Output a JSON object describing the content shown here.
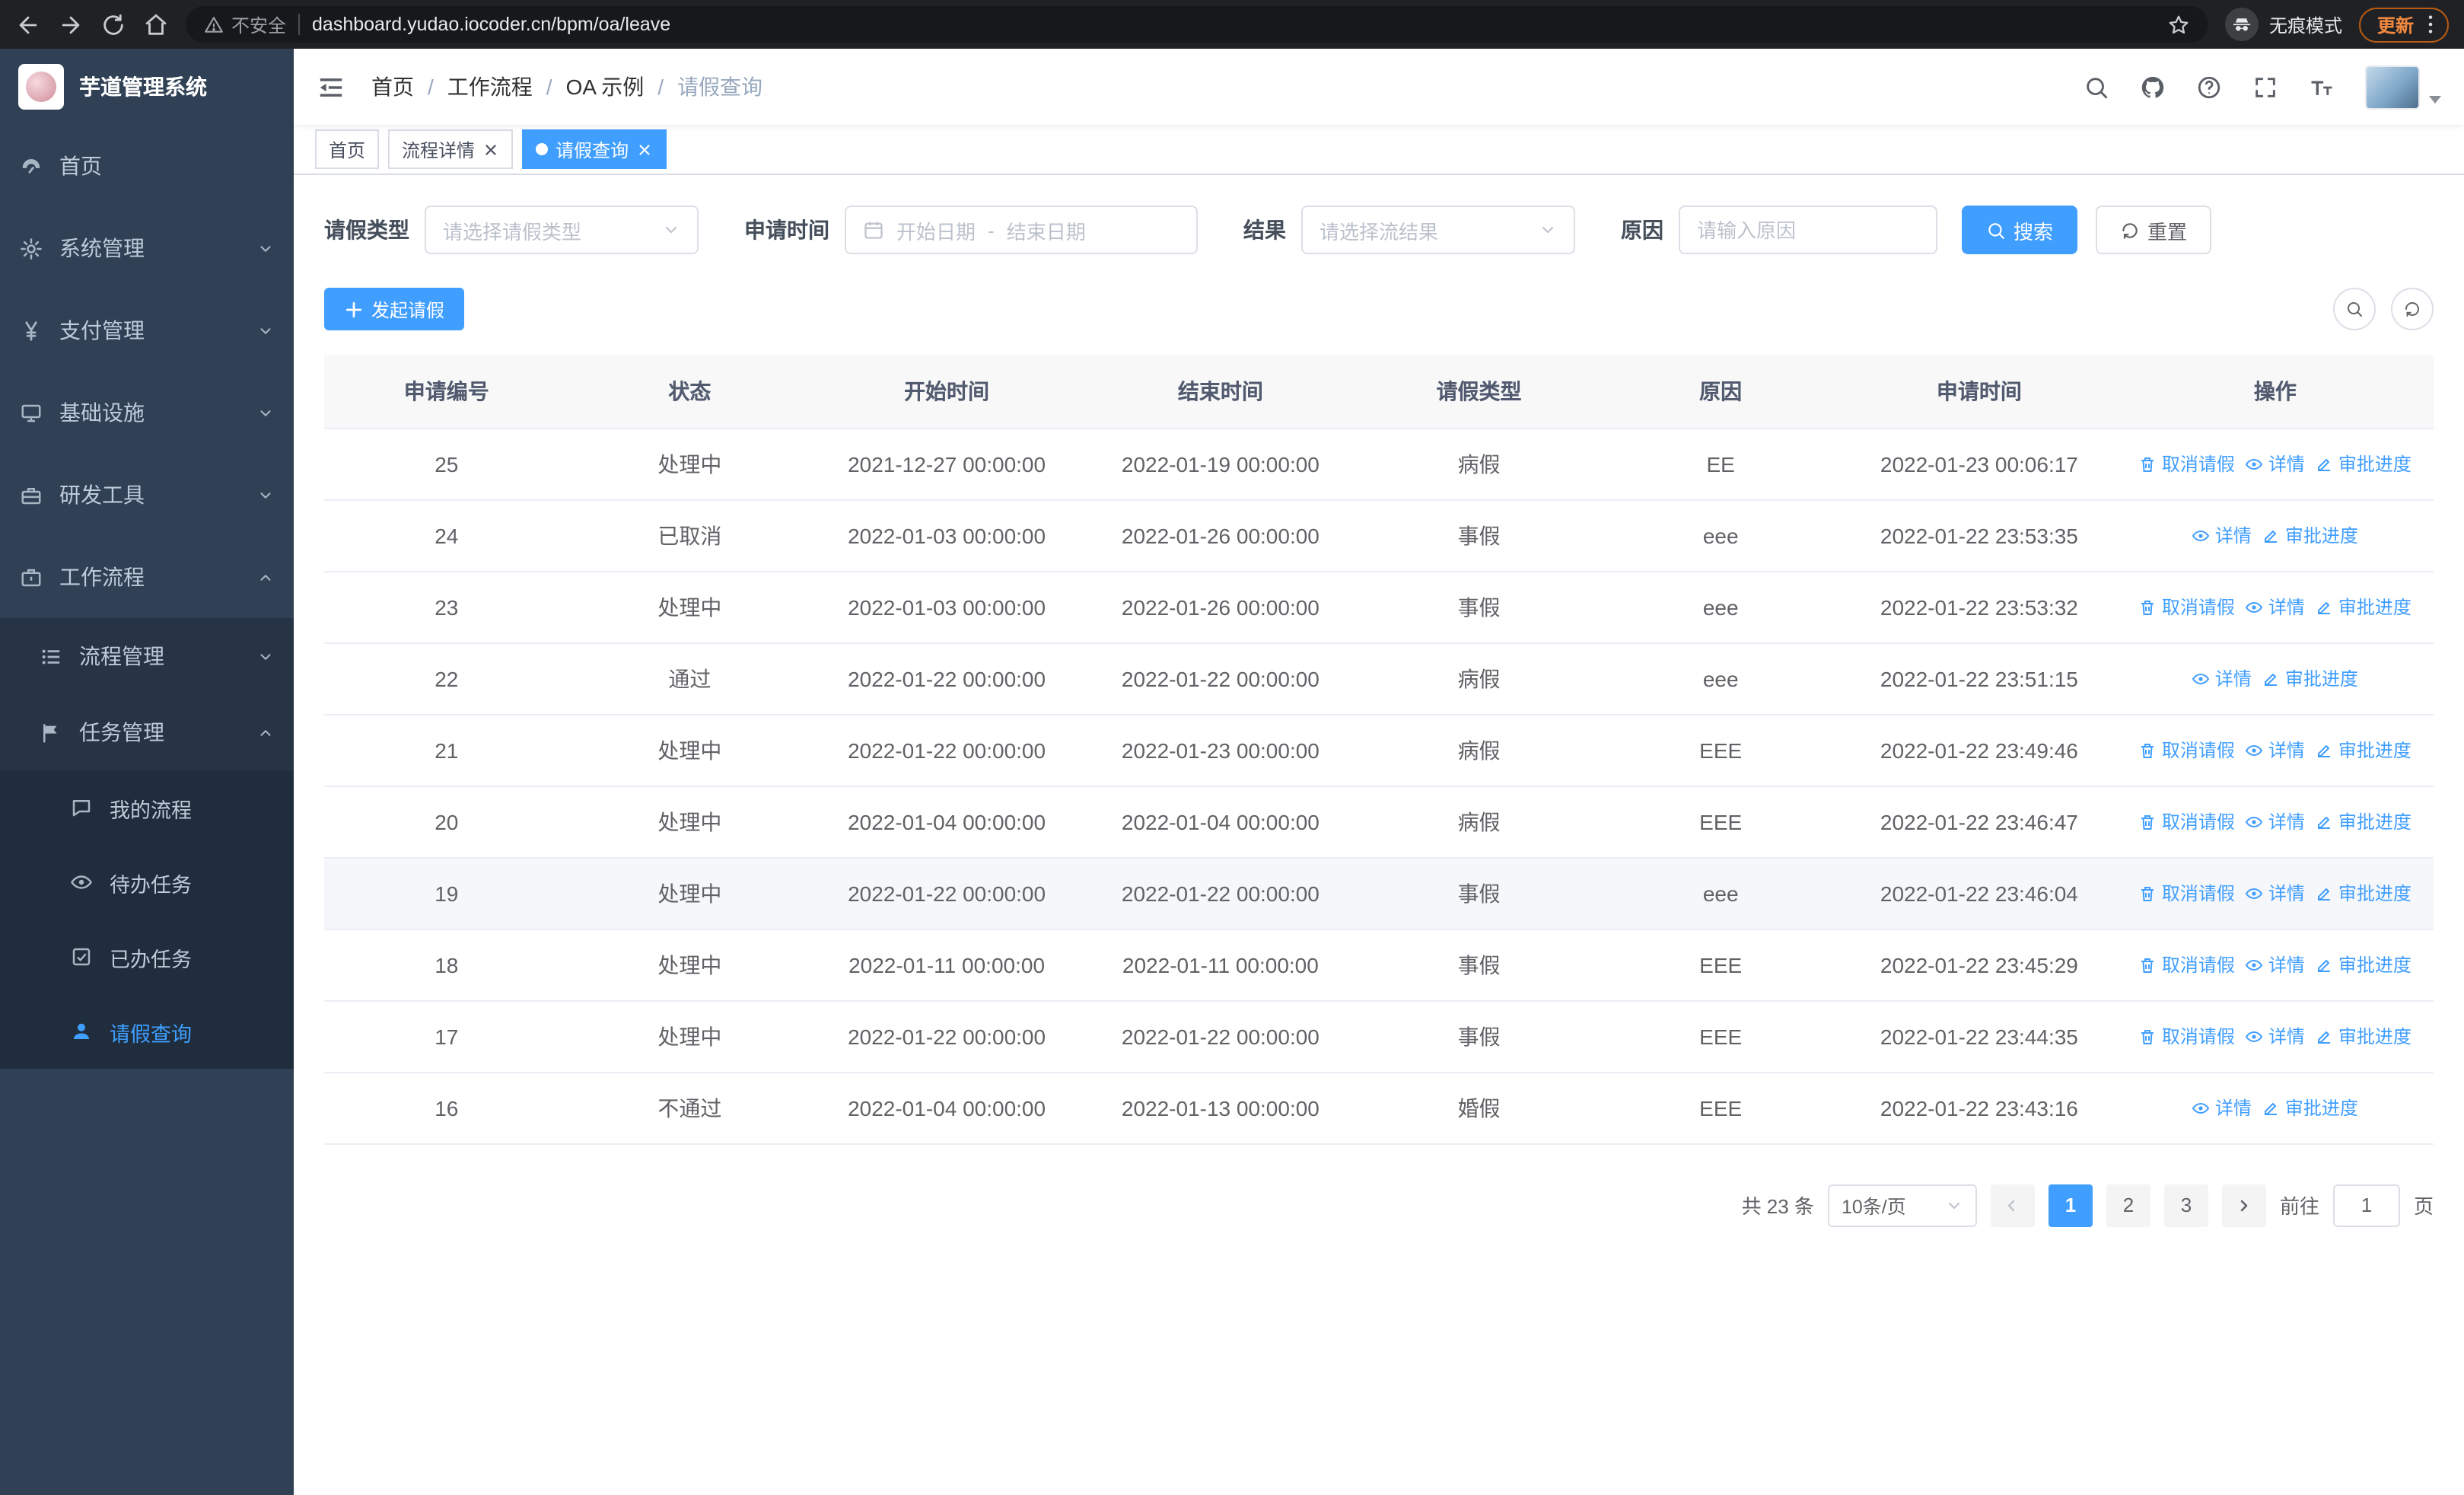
{
  "colors": {
    "accent": "#409eff",
    "sidebar_bg": "#304156",
    "sidebar_sub_bg": "#263445",
    "sidebar_deep_bg": "#1f2d3d",
    "chrome_bg": "#202124",
    "update_orange": "#f0883e",
    "table_header_bg": "#f8f8f9"
  },
  "browser": {
    "security_label": "不安全",
    "url": "dashboard.yudao.iocoder.cn/bpm/oa/leave",
    "incognito_label": "无痕模式",
    "update_label": "更新",
    "icons": [
      "arrow-left-icon",
      "arrow-right-icon",
      "reload-icon",
      "home-icon",
      "warning-icon",
      "star-icon",
      "incognito-icon",
      "dots-vertical-icon"
    ]
  },
  "sidebar": {
    "logo_title": "芋道管理系统",
    "items": [
      {
        "label": "首页",
        "icon": "dashboard-icon",
        "level": 1
      },
      {
        "label": "系统管理",
        "icon": "gear-icon",
        "level": 1,
        "chevron": "down"
      },
      {
        "label": "支付管理",
        "icon": "yen-icon",
        "level": 1,
        "chevron": "down"
      },
      {
        "label": "基础设施",
        "icon": "monitor-icon",
        "level": 1,
        "chevron": "down"
      },
      {
        "label": "研发工具",
        "icon": "toolbox-icon",
        "level": 1,
        "chevron": "down"
      },
      {
        "label": "工作流程",
        "icon": "briefcase-icon",
        "level": 1,
        "chevron": "up"
      },
      {
        "label": "流程管理",
        "icon": "list-icon",
        "level": 2,
        "chevron": "down"
      },
      {
        "label": "任务管理",
        "icon": "flag-icon",
        "level": 2,
        "chevron": "up"
      },
      {
        "label": "我的流程",
        "icon": "chat-icon",
        "level": 3
      },
      {
        "label": "待办任务",
        "icon": "eye-icon",
        "level": 3
      },
      {
        "label": "已办任务",
        "icon": "done-icon",
        "level": 3
      },
      {
        "label": "请假查询",
        "icon": "user-icon",
        "level": 3,
        "active": true
      }
    ]
  },
  "breadcrumb": {
    "separator": "/",
    "items": [
      "首页",
      "工作流程",
      "OA 示例",
      "请假查询"
    ]
  },
  "header_icons": [
    "search-icon",
    "github-icon",
    "help-icon",
    "fullscreen-icon",
    "fontsize-icon"
  ],
  "tabs": [
    {
      "label": "首页",
      "closable": false,
      "active": false
    },
    {
      "label": "流程详情",
      "closable": true,
      "active": false
    },
    {
      "label": "请假查询",
      "closable": true,
      "active": true
    }
  ],
  "filters": {
    "leave_type_label": "请假类型",
    "leave_type_placeholder": "请选择请假类型",
    "apply_time_label": "申请时间",
    "start_date_placeholder": "开始日期",
    "range_separator": "-",
    "end_date_placeholder": "结束日期",
    "result_label": "结果",
    "result_placeholder": "请选择流结果",
    "reason_label": "原因",
    "reason_placeholder": "请输入原因",
    "search_label": "搜索",
    "reset_label": "重置"
  },
  "toolbar": {
    "create_label": "发起请假"
  },
  "table": {
    "columns": [
      "申请编号",
      "状态",
      "开始时间",
      "结束时间",
      "请假类型",
      "原因",
      "申请时间",
      "操作"
    ],
    "action_labels": {
      "cancel": "取消请假",
      "detail": "详情",
      "progress": "审批进度"
    },
    "rows": [
      {
        "id": "25",
        "status": "处理中",
        "start": "2021-12-27 00:00:00",
        "end": "2022-01-19 00:00:00",
        "type": "病假",
        "reason": "EE",
        "applied": "2022-01-23 00:06:17",
        "actions": [
          "cancel",
          "detail",
          "progress"
        ]
      },
      {
        "id": "24",
        "status": "已取消",
        "start": "2022-01-03 00:00:00",
        "end": "2022-01-26 00:00:00",
        "type": "事假",
        "reason": "eee",
        "applied": "2022-01-22 23:53:35",
        "actions": [
          "detail",
          "progress"
        ]
      },
      {
        "id": "23",
        "status": "处理中",
        "start": "2022-01-03 00:00:00",
        "end": "2022-01-26 00:00:00",
        "type": "事假",
        "reason": "eee",
        "applied": "2022-01-22 23:53:32",
        "actions": [
          "cancel",
          "detail",
          "progress"
        ]
      },
      {
        "id": "22",
        "status": "通过",
        "start": "2022-01-22 00:00:00",
        "end": "2022-01-22 00:00:00",
        "type": "病假",
        "reason": "eee",
        "applied": "2022-01-22 23:51:15",
        "actions": [
          "detail",
          "progress"
        ]
      },
      {
        "id": "21",
        "status": "处理中",
        "start": "2022-01-22 00:00:00",
        "end": "2022-01-23 00:00:00",
        "type": "病假",
        "reason": "EEE",
        "applied": "2022-01-22 23:49:46",
        "actions": [
          "cancel",
          "detail",
          "progress"
        ]
      },
      {
        "id": "20",
        "status": "处理中",
        "start": "2022-01-04 00:00:00",
        "end": "2022-01-04 00:00:00",
        "type": "病假",
        "reason": "EEE",
        "applied": "2022-01-22 23:46:47",
        "actions": [
          "cancel",
          "detail",
          "progress"
        ]
      },
      {
        "id": "19",
        "status": "处理中",
        "start": "2022-01-22 00:00:00",
        "end": "2022-01-22 00:00:00",
        "type": "事假",
        "reason": "eee",
        "applied": "2022-01-22 23:46:04",
        "actions": [
          "cancel",
          "detail",
          "progress"
        ],
        "highlight": true
      },
      {
        "id": "18",
        "status": "处理中",
        "start": "2022-01-11 00:00:00",
        "end": "2022-01-11 00:00:00",
        "type": "事假",
        "reason": "EEE",
        "applied": "2022-01-22 23:45:29",
        "actions": [
          "cancel",
          "detail",
          "progress"
        ]
      },
      {
        "id": "17",
        "status": "处理中",
        "start": "2022-01-22 00:00:00",
        "end": "2022-01-22 00:00:00",
        "type": "事假",
        "reason": "EEE",
        "applied": "2022-01-22 23:44:35",
        "actions": [
          "cancel",
          "detail",
          "progress"
        ]
      },
      {
        "id": "16",
        "status": "不通过",
        "start": "2022-01-04 00:00:00",
        "end": "2022-01-13 00:00:00",
        "type": "婚假",
        "reason": "EEE",
        "applied": "2022-01-22 23:43:16",
        "actions": [
          "detail",
          "progress"
        ]
      }
    ]
  },
  "pagination": {
    "total_label": "共 23 条",
    "page_size": "10条/页",
    "pages": [
      "1",
      "2",
      "3"
    ],
    "active_page": "1",
    "goto_label": "前往",
    "goto_value": "1",
    "page_label": "页"
  }
}
